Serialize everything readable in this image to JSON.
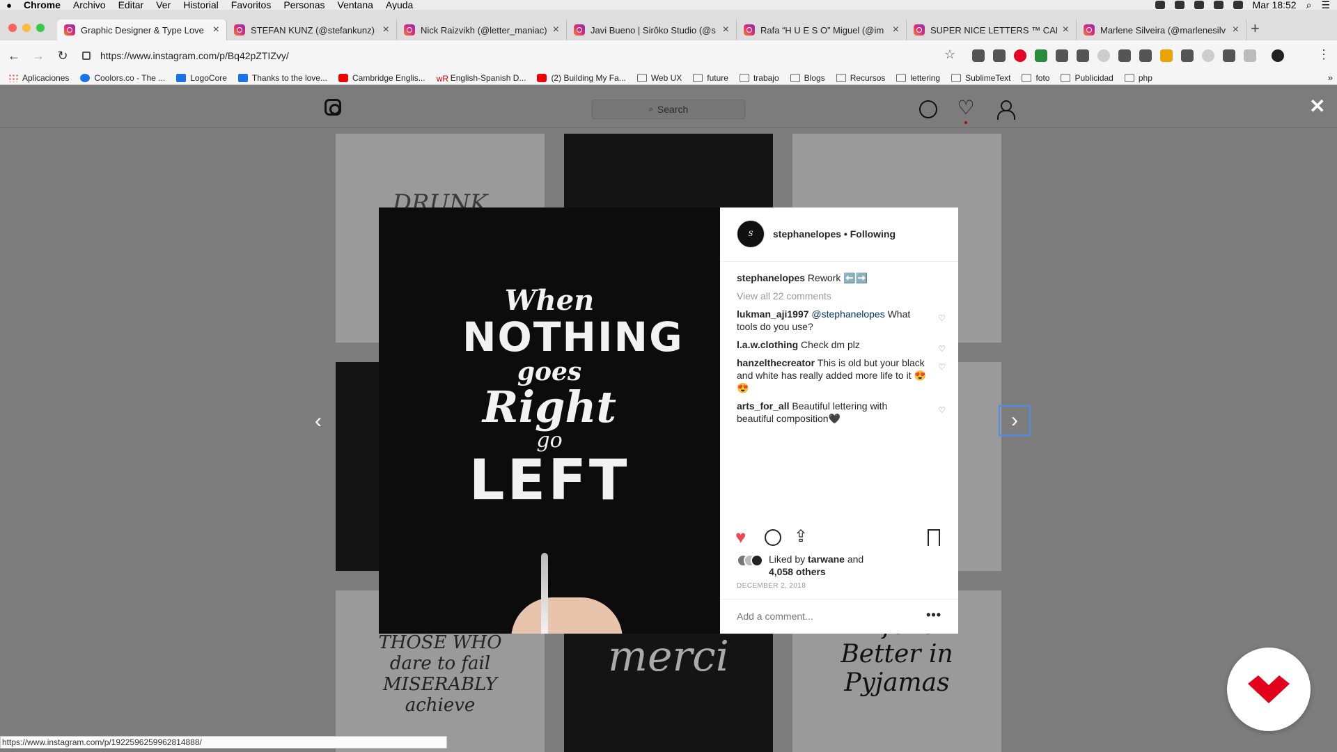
{
  "macos_menu": {
    "app": "Chrome",
    "items": [
      "Archivo",
      "Editar",
      "Ver",
      "Historial",
      "Favoritos",
      "Personas",
      "Ventana",
      "Ayuda"
    ],
    "clock": "Mar 18:52"
  },
  "tabs": [
    {
      "label": "Graphic Designer & Type Love",
      "active": true
    },
    {
      "label": "STEFAN KUNZ (@stefankunz)",
      "active": false
    },
    {
      "label": "Nick Raizvikh (@letter_maniac)",
      "active": false
    },
    {
      "label": "Javi Bueno | Sirôko Studio (@s",
      "active": false
    },
    {
      "label": "Rafa “H U E S O” Miguel (@im",
      "active": false
    },
    {
      "label": "SUPER NICE LETTERS ™ CARN",
      "active": false
    },
    {
      "label": "Marlene Silveira (@marlenesilv",
      "active": false
    }
  ],
  "address": {
    "url": "https://www.instagram.com/p/Bq42pZTIZvy/"
  },
  "bookmarks": [
    {
      "label": "Aplicaciones",
      "icon": "apps-grid-icon"
    },
    {
      "label": "Coolors.co - The ...",
      "icon": "coolors-icon"
    },
    {
      "label": "LogoCore",
      "icon": "logocore-icon"
    },
    {
      "label": "Thanks to the love...",
      "icon": "trello-icon"
    },
    {
      "label": "Cambridge Englis...",
      "icon": "cambridge-icon"
    },
    {
      "label": "English-Spanish D...",
      "icon": "wordreference-icon"
    },
    {
      "label": "(2) Building My Fa...",
      "icon": "youtube-icon"
    },
    {
      "label": "Web UX",
      "icon": "folder-icon"
    },
    {
      "label": "future",
      "icon": "folder-icon"
    },
    {
      "label": "trabajo",
      "icon": "folder-icon"
    },
    {
      "label": "Blogs",
      "icon": "folder-icon"
    },
    {
      "label": "Recursos",
      "icon": "folder-icon"
    },
    {
      "label": "lettering",
      "icon": "folder-icon"
    },
    {
      "label": "SublimeText",
      "icon": "folder-icon"
    },
    {
      "label": "foto",
      "icon": "folder-icon"
    },
    {
      "label": "Publicidad",
      "icon": "folder-icon"
    },
    {
      "label": "php",
      "icon": "folder-icon"
    }
  ],
  "instagram": {
    "search_placeholder": "Search",
    "post": {
      "username": "stephanelopes",
      "follow_state": "Following",
      "caption_user": "stephanelopes",
      "caption_text": "Rework ⬅️➡️",
      "view_all": "View all 22 comments",
      "comments": [
        {
          "user": "lukman_aji1997",
          "mention": "@stephanelopes",
          "text": " What tools do you use?"
        },
        {
          "user": "l.a.w.clothing",
          "mention": "",
          "text": "Check dm plz"
        },
        {
          "user": "hanzelthecreator",
          "mention": "",
          "text": "This is old but your black and white has really added more life to it 😍😍"
        },
        {
          "user": "arts_for_all",
          "mention": "",
          "text": "Beautiful lettering with beautiful composition🖤"
        }
      ],
      "liked_by_prefix": "Liked by ",
      "liked_by_user": "tarwane",
      "liked_by_mid": " and",
      "liked_by_count": "4,058 others",
      "date": "DECEMBER 2, 2018",
      "add_comment_placeholder": "Add a comment...",
      "more_label": "•••"
    },
    "image_text": {
      "line1": "When",
      "line2": "NOTHING",
      "line3": "goes",
      "line4": "Right",
      "line5": "go",
      "line6": "LEFT"
    },
    "thumbs": {
      "t1": "DRUNK",
      "t4": "THOSE WHO dare to fail MISERABLY achieve",
      "t5": "merci",
      "t6": "Life is Better in Pyjamas"
    }
  },
  "status_url": "https://www.instagram.com/p/1922596259962814888/",
  "colors": {
    "like_red": "#ed4956",
    "focus_blue": "#4a8ff0",
    "floating_logo_red": "#e3001b"
  }
}
